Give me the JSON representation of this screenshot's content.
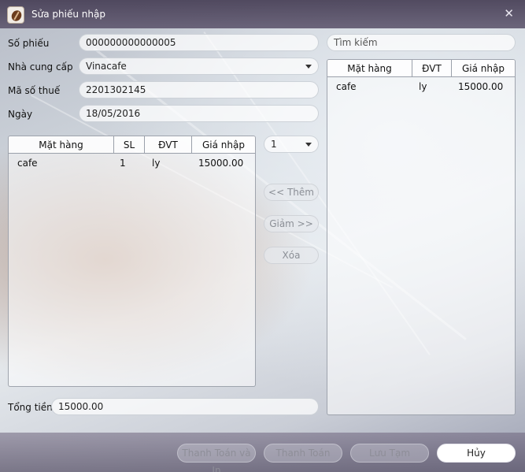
{
  "window": {
    "title": "Sửa phiếu nhập",
    "close_glyph": "✕"
  },
  "form": {
    "so_phieu_label": "Số phiếu",
    "so_phieu_value": "000000000000005",
    "nha_cung_cap_label": "Nhà cung cấp",
    "nha_cung_cap_value": "Vinacafe",
    "ma_so_thue_label": "Mã số thuế",
    "ma_so_thue_value": "2201302145",
    "ngay_label": "Ngày",
    "ngay_value": "18/05/2016",
    "tong_tien_label": "Tổng tiền",
    "tong_tien_value": "15000.00"
  },
  "left_table": {
    "headers": [
      "Mặt hàng",
      "SL",
      "ĐVT",
      "Giá nhập"
    ],
    "rows": [
      [
        "cafe",
        "1",
        "ly",
        "15000.00"
      ]
    ]
  },
  "quantity_select": {
    "value": "1"
  },
  "middle_buttons": {
    "them": "<< Thêm",
    "giam": "Giảm >>",
    "xoa": "Xóa"
  },
  "search": {
    "placeholder": "Tìm kiếm"
  },
  "right_table": {
    "headers": [
      "Mặt hàng",
      "ĐVT",
      "Giá nhập"
    ],
    "rows": [
      [
        "cafe",
        "ly",
        "15000.00"
      ]
    ]
  },
  "footer": {
    "thanh_toan_va_in": "Thanh Toán và In",
    "thanh_toan": "Thanh Toán",
    "luu_tam": "Lưu Tạm",
    "huy": "Hủy"
  },
  "icons": {
    "app": "coffee-bean-icon",
    "close": "close-icon",
    "dropdown": "chevron-down-icon"
  }
}
